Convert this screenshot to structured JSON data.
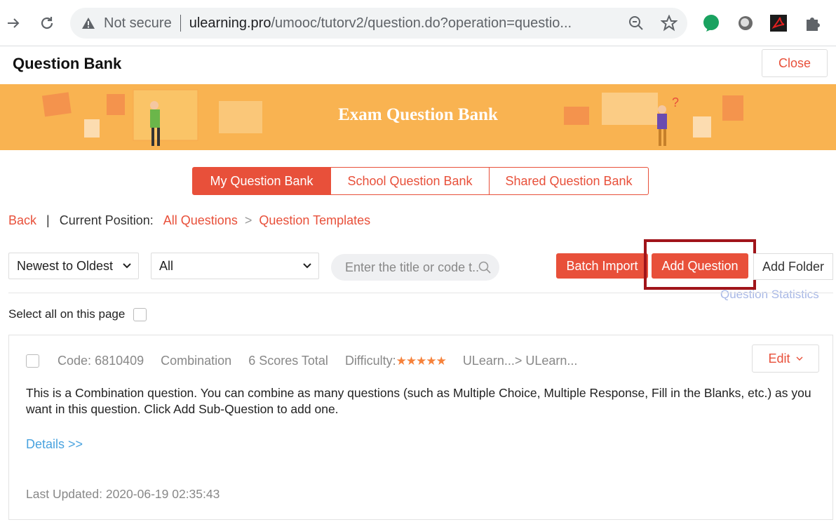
{
  "browser": {
    "security_label": "Not secure",
    "url_host": "ulearning.pro",
    "url_path": "/umooc/tutorv2/question.do?operation=questio..."
  },
  "header": {
    "title": "Question Bank",
    "close_label": "Close"
  },
  "banner": {
    "title": "Exam Question Bank"
  },
  "tabs": [
    {
      "label": "My Question Bank",
      "active": true
    },
    {
      "label": "School Question Bank",
      "active": false
    },
    {
      "label": "Shared Question Bank",
      "active": false
    }
  ],
  "breadcrumb": {
    "back": "Back",
    "bar": "|",
    "current_label": "Current Position:",
    "all_questions": "All Questions",
    "gt": ">",
    "templates": "Question Templates"
  },
  "toolbar": {
    "sort_value": "Newest to Oldest",
    "filter_value": "All",
    "search_placeholder": "Enter the title or code t...",
    "batch_import": "Batch Import",
    "add_question": "Add Question",
    "add_folder": "Add Folder",
    "question_statistics": "Question Statistics"
  },
  "select_all_label": "Select all on this page",
  "question": {
    "code_label": "Code:",
    "code": "6810409",
    "type": "Combination",
    "scores": "6 Scores Total",
    "difficulty_label": "Difficulty:",
    "difficulty_stars": 5,
    "stars_text": "★★★★★",
    "path": "ULearn...> ULearn...",
    "edit_label": "Edit",
    "description": "This is a Combination question. You can combine as many questions (such as Multiple Choice, Multiple Response, Fill in the Blanks, etc.) as you want in this question. Click Add Sub-Question to add one.",
    "details_link": "Details >>",
    "updated_label": "Last Updated:",
    "updated_value": "2020-06-19 02:35:43"
  },
  "colors": {
    "accent": "#e8503a",
    "banner": "#f9b351",
    "link_blue": "#4aa3df",
    "highlight_box": "#a0141a"
  }
}
